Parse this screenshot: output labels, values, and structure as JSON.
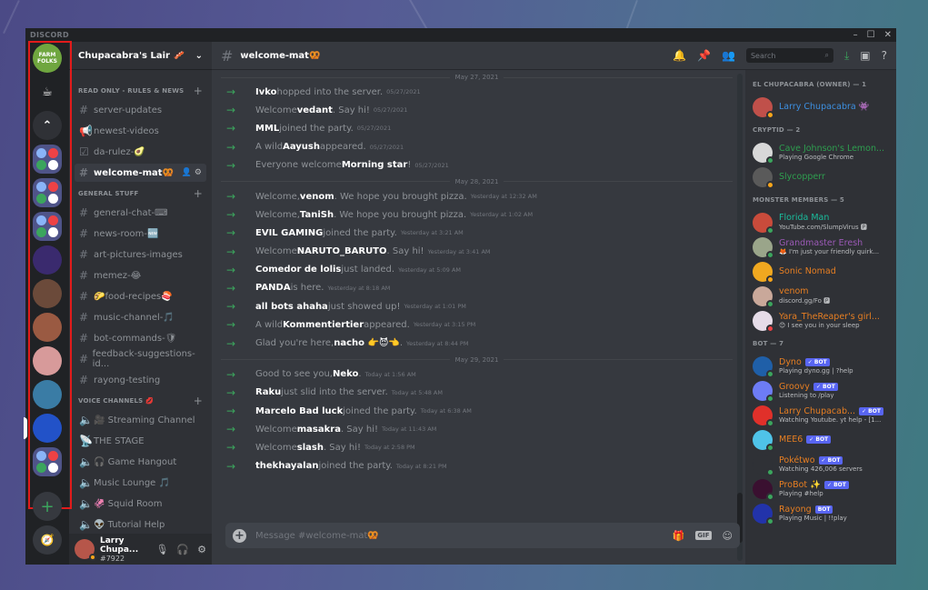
{
  "window": {
    "brand": "DISCORD",
    "controls": {
      "minimize": "–",
      "maximize": "☐",
      "close": "✕"
    }
  },
  "guilds": [
    {
      "name": "farm-folks",
      "label": "FARM FOLKS",
      "color": "#6fa63f"
    },
    {
      "name": "coffee",
      "label": "☕",
      "color": "#202225"
    },
    {
      "name": "rank",
      "label": "⌃",
      "color": "#2f3136"
    },
    {
      "name": "folder-1",
      "label": "",
      "color": "#4f5489",
      "folder": true
    },
    {
      "name": "folder-2",
      "label": "",
      "color": "#4f5489",
      "folder": true
    },
    {
      "name": "folder-3",
      "label": "",
      "color": "#4f5489",
      "folder": true
    },
    {
      "name": "purple",
      "label": "",
      "color": "#3a2a6e"
    },
    {
      "name": "painting",
      "label": "",
      "color": "#6b4a3a"
    },
    {
      "name": "bacon",
      "label": "",
      "color": "#9a5a42"
    },
    {
      "name": "pink",
      "label": "",
      "color": "#d79a9a"
    },
    {
      "name": "ocean",
      "label": "",
      "color": "#3a7ca5"
    },
    {
      "name": "chupacabra",
      "label": "",
      "color": "#2252c8",
      "active": true
    },
    {
      "name": "folder-4",
      "label": "",
      "color": "#4f5489",
      "folder": true
    }
  ],
  "guild_actions": {
    "add": "+",
    "explore": "🧭"
  },
  "server": {
    "name": "Chupacabra's Lair 🥓",
    "chevron": "⌄"
  },
  "categories": [
    {
      "name": "READ ONLY - RULES & NEWS",
      "channels": [
        {
          "name": "server-updates",
          "icon": "#"
        },
        {
          "name": "newest-videos",
          "icon": "📢"
        },
        {
          "name": "da-rulez-🥑",
          "icon": "☑"
        },
        {
          "name": "welcome-mat🥨",
          "icon": "#",
          "active": true
        }
      ]
    },
    {
      "name": "GENERAL STUFF",
      "channels": [
        {
          "name": "general-chat-⌨",
          "icon": "#"
        },
        {
          "name": "news-room-🆕",
          "icon": "#"
        },
        {
          "name": "art-pictures-images",
          "icon": "#"
        },
        {
          "name": "memez-😂",
          "icon": "#"
        },
        {
          "name": "🌮food-recipes🍣",
          "icon": "#"
        },
        {
          "name": "music-channel-🎵",
          "icon": "#"
        },
        {
          "name": "bot-commands-🛡",
          "icon": "#"
        },
        {
          "name": "feedback-suggestions-id...",
          "icon": "#"
        },
        {
          "name": "rayong-testing",
          "icon": "#"
        }
      ]
    },
    {
      "name": "VOICE CHANNELS 💋",
      "channels": [
        {
          "name": "🎥 Streaming Channel",
          "icon": "🔈"
        },
        {
          "name": "THE STAGE",
          "icon": "📡"
        },
        {
          "name": "🎧 Game Hangout",
          "icon": "🔈"
        },
        {
          "name": "Music Lounge 🎵",
          "icon": "🔈"
        },
        {
          "name": "🦑 Squid Room",
          "icon": "🔈"
        },
        {
          "name": "👽 Tutorial Help",
          "icon": "🔈"
        }
      ]
    }
  ],
  "user": {
    "name": "Larry Chupa...",
    "tag": "#7922"
  },
  "channel": {
    "title": "welcome-mat🥨"
  },
  "search": {
    "placeholder": "Search"
  },
  "dividers": [
    "May 27, 2021",
    "May 28, 2021",
    "May 29, 2021"
  ],
  "messages": [
    {
      "group": 0,
      "pre": "",
      "user": "Ivko",
      "post": " hopped into the server.",
      "ts": "05/27/2021"
    },
    {
      "group": 0,
      "pre": "Welcome ",
      "user": "vedant",
      "post": ". Say hi!",
      "ts": "05/27/2021"
    },
    {
      "group": 0,
      "pre": "",
      "user": "MML",
      "post": " joined the party.",
      "ts": "05/27/2021"
    },
    {
      "group": 0,
      "pre": "A wild ",
      "user": "Aayush",
      "post": " appeared.",
      "ts": "05/27/2021"
    },
    {
      "group": 0,
      "pre": "Everyone welcome ",
      "user": "Morning star",
      "post": "!",
      "ts": "05/27/2021"
    },
    {
      "group": 1,
      "pre": "Welcome, ",
      "user": "venom",
      "post": ". We hope you brought pizza.",
      "ts": "Yesterday at 12:32 AM"
    },
    {
      "group": 1,
      "pre": "Welcome, ",
      "user": "TaniSh",
      "post": ". We hope you brought pizza.",
      "ts": "Yesterday at 1:02 AM"
    },
    {
      "group": 1,
      "pre": "",
      "user": "EVIL GAMING",
      "post": " joined the party.",
      "ts": "Yesterday at 3:21 AM"
    },
    {
      "group": 1,
      "pre": "Welcome ",
      "user": "NARUTO_BARUTO",
      "post": ". Say hi!",
      "ts": "Yesterday at 3:41 AM"
    },
    {
      "group": 1,
      "pre": "",
      "user": "Comedor de lolis",
      "post": " just landed.",
      "ts": "Yesterday at 5:09 AM"
    },
    {
      "group": 1,
      "pre": "",
      "user": "PANDA",
      "post": " is here.",
      "ts": "Yesterday at 8:18 AM"
    },
    {
      "group": 1,
      "pre": "",
      "user": "all bots ahaha",
      "post": " just showed up!",
      "ts": "Yesterday at 1:01 PM"
    },
    {
      "group": 1,
      "pre": "A wild ",
      "user": "Kommentiertier",
      "post": " appeared.",
      "ts": "Yesterday at 3:15 PM"
    },
    {
      "group": 1,
      "pre": "Glad you're here, ",
      "user": "nacho 👉😈👈",
      "post": ".",
      "ts": "Yesterday at 8:44 PM"
    },
    {
      "group": 2,
      "pre": "Good to see you, ",
      "user": "Neko",
      "post": ".",
      "ts": "Today at 1:56 AM"
    },
    {
      "group": 2,
      "pre": "",
      "user": "Raku",
      "post": " just slid into the server.",
      "ts": "Today at 5:48 AM"
    },
    {
      "group": 2,
      "pre": "",
      "user": "Marcelo Bad luck",
      "post": " joined the party.",
      "ts": "Today at 6:38 AM"
    },
    {
      "group": 2,
      "pre": "Welcome ",
      "user": "masakra",
      "post": ". Say hi!",
      "ts": "Today at 11:43 AM"
    },
    {
      "group": 2,
      "pre": "Welcome ",
      "user": "slash",
      "post": ". Say hi!",
      "ts": "Today at 2:58 PM"
    },
    {
      "group": 2,
      "pre": "",
      "user": "thekhayalan",
      "post": " joined the party.",
      "ts": "Today at 8:21 PM"
    }
  ],
  "composer": {
    "placeholder": "Message #welcome-mat🥨",
    "gif": "GIF"
  },
  "member_groups": [
    {
      "title": "EL CHUPACABRA (OWNER) — 1",
      "members": [
        {
          "name": "Larry Chupacabra 👾",
          "activity": "",
          "color": "#3d8fe0",
          "status": "#faa61a",
          "avatar": "#c0504a"
        }
      ]
    },
    {
      "title": "CRYPTID — 2",
      "members": [
        {
          "name": "Cave Johnson's Lemon...",
          "activity": "Playing Google Chrome",
          "color": "#2e9e4f",
          "status": "#3ba55d",
          "avatar": "#d8d8d8"
        },
        {
          "name": "Slycopperr",
          "activity": "",
          "color": "#2e9e4f",
          "status": "#faa61a",
          "avatar": "#5a5a5a"
        }
      ]
    },
    {
      "title": "MONSTER MEMBERS — 5",
      "members": [
        {
          "name": "Florida Man",
          "activity": "YouTube.com/SlumpVirus 🅿",
          "color": "#1abc9c",
          "status": "#3ba55d",
          "avatar": "#c94b3b"
        },
        {
          "name": "Grandmaster Eresh",
          "activity": "🦊 I'm just your friendly quirk...",
          "color": "#9b59b6",
          "status": "#3ba55d",
          "avatar": "#9aa58a"
        },
        {
          "name": "Sonic Nomad",
          "activity": "",
          "color": "#e67e22",
          "status": "#faa61a",
          "avatar": "#f0a820"
        },
        {
          "name": "venom",
          "activity": "discord.gg/Fo 🅿",
          "color": "#e67e22",
          "status": "#3ba55d",
          "avatar": "#c9a89a"
        },
        {
          "name": "Yara_TheReaper's girl...",
          "activity": "😊 I see you in your sleep",
          "color": "#e67e22",
          "status": "#ed4245",
          "avatar": "#e6dce8"
        }
      ]
    },
    {
      "title": "BOT — 7",
      "members": [
        {
          "name": "Dyno",
          "bot": "✓ BOT",
          "activity": "Playing dyno.gg | ?help",
          "color": "#e67e22",
          "status": "#3ba55d",
          "avatar": "#1f5fa8"
        },
        {
          "name": "Groovy",
          "bot": "✓ BOT",
          "activity": "Listening to /play",
          "color": "#e67e22",
          "status": "#3ba55d",
          "avatar": "#6d7cf5"
        },
        {
          "name": "Larry Chupacab...",
          "bot": "✓ BOT",
          "activity": "Watching Youtube. yt help - [1...",
          "color": "#e67e22",
          "status": "#3ba55d",
          "avatar": "#e0302a"
        },
        {
          "name": "MEE6",
          "bot": "✓ BOT",
          "activity": "",
          "color": "#e67e22",
          "status": "#3ba55d",
          "avatar": "#4fc3e8"
        },
        {
          "name": "Pokétwo",
          "bot": "✓ BOT",
          "activity": "Watching 426,006 servers",
          "color": "#e67e22",
          "status": "#3ba55d",
          "avatar": "#2f3136"
        },
        {
          "name": "ProBot ✨",
          "bot": "✓ BOT",
          "activity": "Playing #help",
          "color": "#e67e22",
          "status": "#3ba55d",
          "avatar": "#3a1030"
        },
        {
          "name": "Rayong",
          "bot": "BOT",
          "activity": "Playing Music | !!play",
          "color": "#e67e22",
          "status": "#3ba55d",
          "avatar": "#2233aa"
        }
      ]
    }
  ]
}
